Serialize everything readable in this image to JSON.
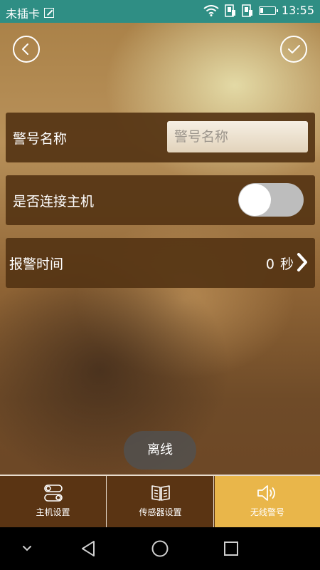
{
  "status_bar": {
    "carrier": "未插卡",
    "time": "13:55",
    "icons": [
      "sim-card-icon",
      "wifi-icon",
      "alarm-indicator-icon",
      "alarm-indicator-icon",
      "battery-icon"
    ],
    "background_color": "#2f8e84"
  },
  "header": {
    "back_icon": "chevron-left-icon",
    "confirm_icon": "checkmark-icon"
  },
  "form": {
    "name_label": "警号名称",
    "name_placeholder": "警号名称",
    "name_value": "",
    "connect_label": "是否连接主机",
    "connect_on": false,
    "time_label": "报警时间",
    "time_value": "0",
    "time_unit": "秒",
    "time_icon": "chevron-right-icon"
  },
  "toast": "离线",
  "tabs": [
    {
      "label": "主机设置",
      "icon": "toggle-switches-icon",
      "active": false
    },
    {
      "label": "传感器设置",
      "icon": "book-icon",
      "active": false
    },
    {
      "label": "无线警号",
      "icon": "speaker-icon",
      "active": true
    }
  ],
  "colors": {
    "row_background": "#553414",
    "active_tab": "#e9b64a",
    "tab_background": "#5a3413"
  },
  "nav_bar": {
    "icons": [
      "chevron-down-icon",
      "back-triangle-icon",
      "home-circle-icon",
      "recents-square-icon"
    ]
  }
}
